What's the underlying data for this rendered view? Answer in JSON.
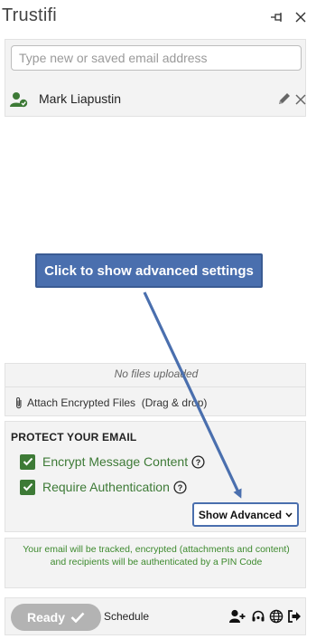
{
  "app": {
    "title": "Trustifi"
  },
  "recipients": {
    "input_placeholder": "Type new or saved email address",
    "input_value": "",
    "items": [
      {
        "name": "Mark Liapustin",
        "icon": "verified-user-icon"
      }
    ]
  },
  "callout": {
    "text": "Click to show advanced settings"
  },
  "files": {
    "empty_text": "No files uploaded",
    "attach_label": "Attach Encrypted Files  (Drag & drop)"
  },
  "protect": {
    "title": "PROTECT YOUR EMAIL",
    "options": [
      {
        "label": "Encrypt Message Content",
        "checked": true
      },
      {
        "label": "Require Authentication",
        "checked": true
      }
    ],
    "show_advanced_label": "Show Advanced"
  },
  "info": {
    "line1": "Your email will be tracked, encrypted (attachments and content)",
    "line2": "and recipients will be authenticated by a PIN Code"
  },
  "footer": {
    "ready_label": "Ready",
    "schedule_label": "Schedule",
    "icons": [
      "add-contact-icon",
      "support-headset-icon",
      "globe-icon",
      "sign-out-icon"
    ]
  },
  "colors": {
    "accent_blue": "#4a6fae",
    "success_green": "#3d7a36",
    "info_green": "#3d8a2e",
    "ready_gray": "#b3b3b3"
  }
}
